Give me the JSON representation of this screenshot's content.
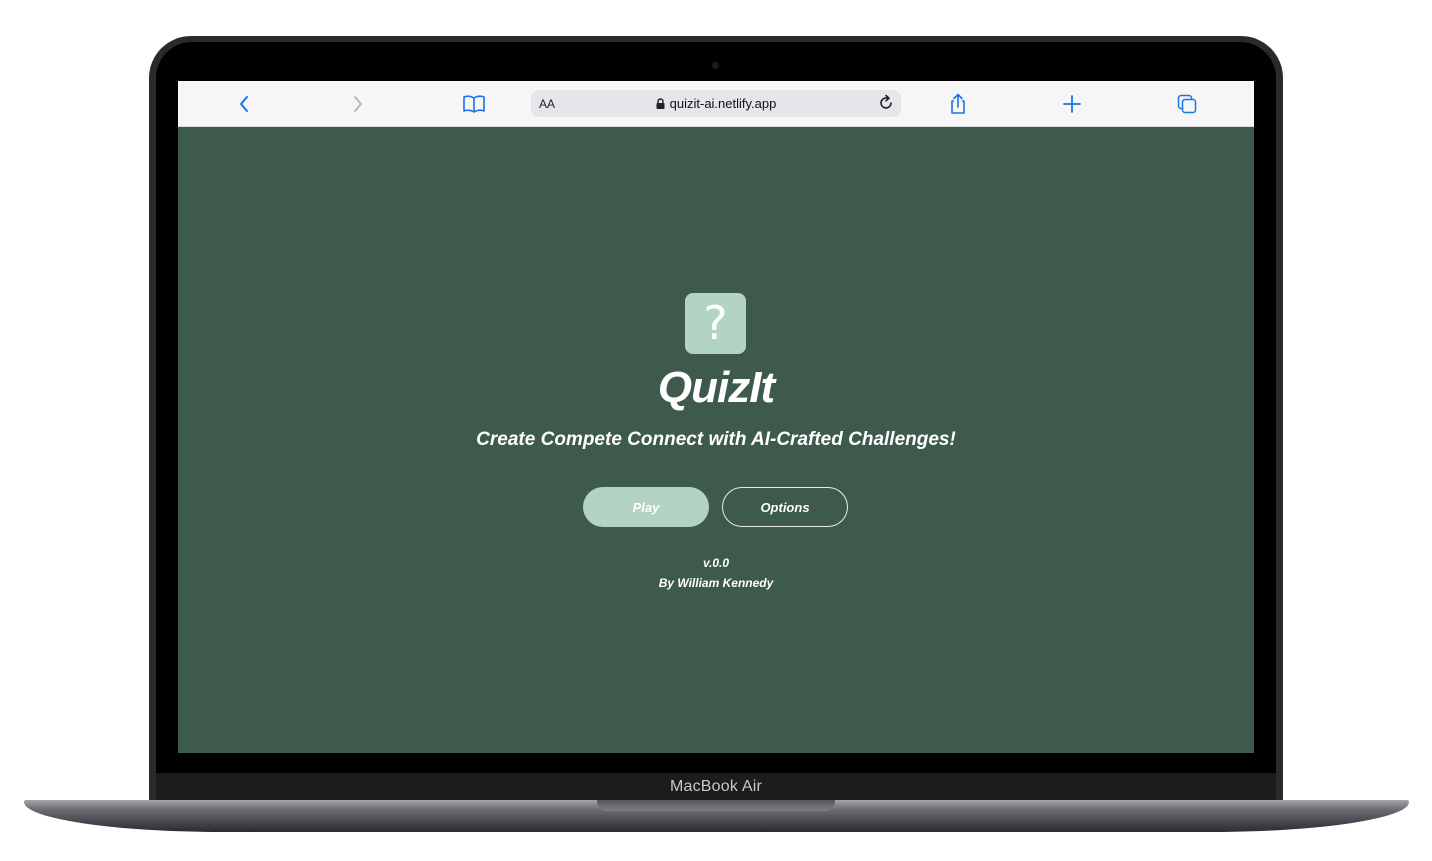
{
  "device": {
    "model_label": "MacBook Air"
  },
  "browser": {
    "text_size_label": "AA",
    "url": "quizit-ai.netlify.app",
    "icons": {
      "back": "chevron-left-icon",
      "forward": "chevron-right-icon",
      "bookmarks": "book-icon",
      "lock": "lock-icon",
      "reload": "reload-icon",
      "share": "share-icon",
      "new_tab": "plus-icon",
      "tabs": "tabs-icon"
    },
    "accent_color": "#1a73e8"
  },
  "app": {
    "logo_glyph": "?",
    "title": "QuizIt",
    "tagline": "Create Compete Connect with AI-Crafted Challenges!",
    "buttons": {
      "play": "Play",
      "options": "Options"
    },
    "version": "v.0.0",
    "author": "By William Kennedy",
    "colors": {
      "background": "#3e5a4c",
      "accent": "#b3d3c3",
      "text": "#ffffff"
    }
  }
}
